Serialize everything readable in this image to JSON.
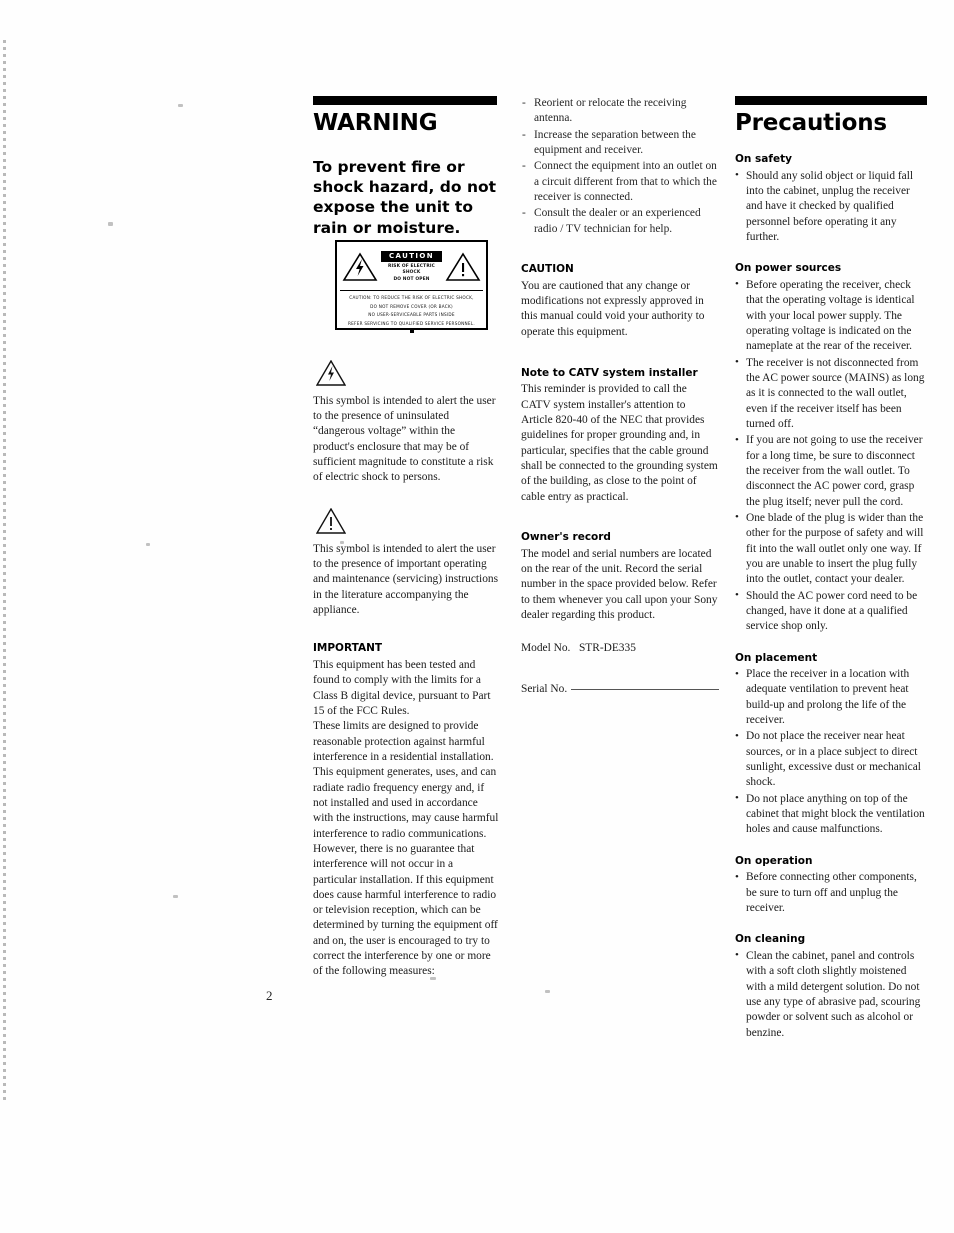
{
  "page": {
    "number": "2"
  },
  "warning": {
    "heading": "WARNING",
    "lead": "To prevent fire or shock hazard, do not expose the unit to rain or moisture.",
    "label_box": {
      "caution_word": "CAUTION",
      "risk_line_1": "RISK OF ELECTRIC SHOCK",
      "risk_line_2": "DO NOT OPEN",
      "notice_1": "CAUTION: TO REDUCE THE RISK OF ELECTRIC SHOCK,",
      "notice_2": "DO NOT REMOVE COVER (OR BACK)",
      "notice_3": "NO USER-SERVICEABLE PARTS INSIDE",
      "notice_4": "REFER SERVICING TO QUALIFIED SERVICE PERSONNEL."
    },
    "symbol_lightning_text": "This symbol is intended to alert the user to the presence of uninsulated “dangerous voltage” within the product's enclosure that may be of sufficient magnitude to constitute a risk of electric shock to persons.",
    "symbol_exclamation_text": "This symbol is intended to alert the user to the presence of important operating and maintenance (servicing) instructions in the literature accompanying the appliance.",
    "important": {
      "heading": "IMPORTANT",
      "paragraph_1": "This equipment has been tested and found to comply with the limits for a Class B digital device, pursuant to Part 15 of the FCC Rules.",
      "paragraph_2": "These limits are designed to provide reasonable protection against harmful interference in a residential installation. This equipment generates, uses, and can radiate radio frequency energy and, if not installed and used in accordance with the instructions, may cause harmful interference to radio communications. However, there is no guarantee that interference will not occur in a particular installation. If this equipment does cause harmful interference to radio or television reception, which can be determined by turning the equipment off and on, the user is encouraged to try to correct the interference by one or more of the following measures:"
    }
  },
  "middle": {
    "remedies": [
      "Reorient or relocate the receiving antenna.",
      "Increase the separation between the equipment and receiver.",
      "Connect the equipment into an outlet on a circuit different from that to which the receiver is connected.",
      "Consult the dealer or an experienced radio / TV technician for help."
    ],
    "caution": {
      "heading": "CAUTION",
      "text": "You are cautioned that any change or modifications not expressly approved in this manual could void your authority to operate this equipment."
    },
    "catv": {
      "heading": "Note to CATV system installer",
      "text": "This reminder is provided to call the CATV system installer's attention to Article 820-40 of the NEC that provides guidelines for proper grounding and, in particular, specifies that the cable ground shall be connected to the grounding system of the building, as close to the point of cable entry as practical."
    },
    "owners_record": {
      "heading": "Owner's record",
      "text": "The model and serial numbers are located on the rear of the unit. Record the serial number in the space provided below. Refer to them whenever you call upon your Sony dealer regarding this product.",
      "model_label": "Model No.",
      "model_value": "STR-DE335",
      "serial_label": "Serial No."
    }
  },
  "precautions": {
    "heading": "Precautions",
    "sections": [
      {
        "heading": "On safety",
        "items": [
          "Should any solid object or liquid fall into the cabinet, unplug the receiver and have it checked by qualified personnel before operating it any further."
        ]
      },
      {
        "heading": "On power sources",
        "items": [
          "Before operating the receiver, check that the operating voltage is identical with your local power supply. The operating voltage is indicated on the nameplate at the rear of the receiver.",
          "The receiver is not disconnected from the AC power source (MAINS) as long as it is connected to the wall outlet, even if the receiver itself has been turned off.",
          "If you are not going to use the receiver for a long time, be sure to disconnect the receiver from the wall outlet. To disconnect the AC power cord, grasp the plug itself; never pull the cord.",
          "One blade of the plug is wider than the other for the purpose of safety and will fit into the wall outlet only one way. If you are unable to insert the plug fully into the outlet, contact your dealer.",
          "Should the AC power cord need to be changed, have it done at a qualified service shop only."
        ]
      },
      {
        "heading": "On placement",
        "items": [
          "Place the receiver in a location with adequate ventilation to prevent heat build-up and prolong the life of the receiver.",
          "Do not place the receiver near heat sources, or in a place subject to direct sunlight, excessive dust or mechanical shock.",
          "Do not place anything on top of the cabinet that might block the ventilation holes and cause malfunctions."
        ]
      },
      {
        "heading": "On operation",
        "items": [
          "Before connecting other components, be sure to turn off and unplug the receiver."
        ]
      },
      {
        "heading": "On cleaning",
        "items": [
          "Clean the cabinet, panel and controls with a soft cloth slightly moistened with a mild detergent solution. Do not use any type of abrasive pad, scouring powder or solvent such as alcohol or benzine."
        ]
      }
    ]
  }
}
